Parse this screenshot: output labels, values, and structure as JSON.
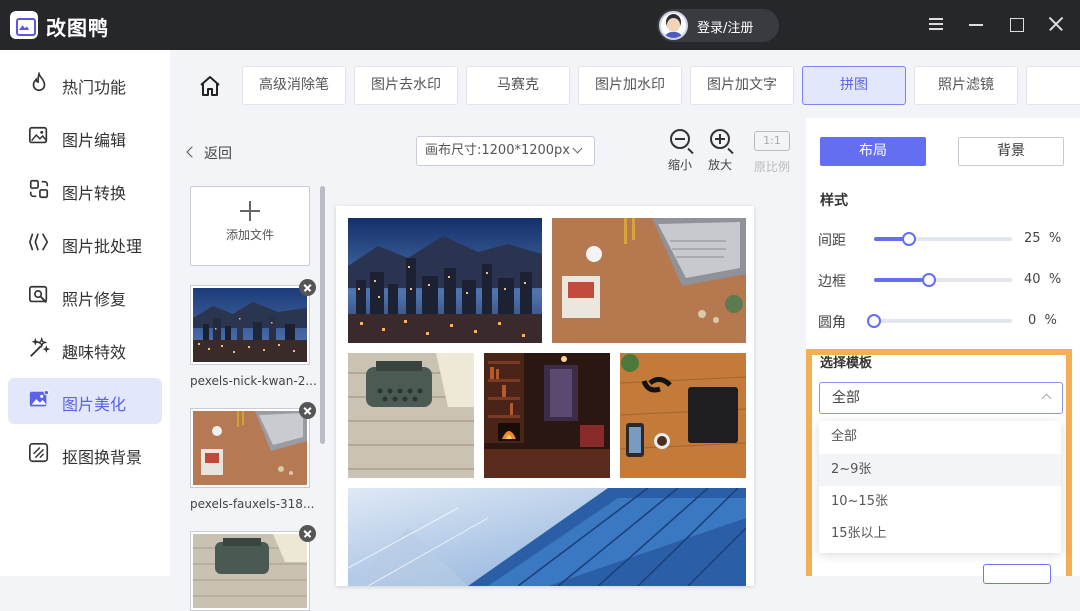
{
  "app": {
    "title": "改图鸭",
    "login_label": "登录/注册"
  },
  "sidebar": {
    "items": [
      {
        "label": "热门功能",
        "icon": "flame-icon"
      },
      {
        "label": "图片编辑",
        "icon": "image-edit-icon"
      },
      {
        "label": "图片转换",
        "icon": "convert-icon"
      },
      {
        "label": "图片批处理",
        "icon": "batch-icon"
      },
      {
        "label": "照片修复",
        "icon": "photo-repair-icon"
      },
      {
        "label": "趣味特效",
        "icon": "magic-wand-icon"
      },
      {
        "label": "图片美化",
        "icon": "beautify-icon",
        "active": true
      },
      {
        "label": "抠图换背景",
        "icon": "cutout-icon"
      }
    ]
  },
  "toolbar": {
    "tools": [
      {
        "label": "高级消除笔"
      },
      {
        "label": "图片去水印"
      },
      {
        "label": "马赛克"
      },
      {
        "label": "图片加水印"
      },
      {
        "label": "图片加文字"
      },
      {
        "label": "拼图",
        "active": true
      },
      {
        "label": "照片滤镜"
      }
    ]
  },
  "editor": {
    "back_label": "返回",
    "canvas_size": "画布尺寸:1200*1200px",
    "zoom_out_label": "缩小",
    "zoom_in_label": "放大",
    "ratio_button": "1:1",
    "ratio_label": "原比例"
  },
  "files": {
    "add_label": "添加文件",
    "items": [
      {
        "name": "pexels-nick-kwan-2...",
        "image": "city-night-skyline"
      },
      {
        "name": "pexels-fauxels-318...",
        "image": "desk-laptop"
      },
      {
        "name": "",
        "image": "typewriter"
      }
    ]
  },
  "collage": {
    "tiles": [
      {
        "name": "city-night-skyline"
      },
      {
        "name": "desk-laptop"
      },
      {
        "name": "typewriter"
      },
      {
        "name": "cozy-room-fireplace"
      },
      {
        "name": "desk-phone-glasses"
      },
      {
        "name": "glass-building"
      }
    ]
  },
  "right_panel": {
    "tab_layout": "布局",
    "tab_background": "背景",
    "style_title": "样式",
    "sliders": [
      {
        "label": "间距",
        "value": 25,
        "unit": "%"
      },
      {
        "label": "边框",
        "value": 40,
        "unit": "%"
      },
      {
        "label": "圆角",
        "value": 0,
        "unit": "%"
      }
    ],
    "template_title": "选择模板",
    "template_selected": "全部",
    "template_options": [
      "全部",
      "2~9张",
      "10~15张",
      "15张以上"
    ]
  },
  "colors": {
    "accent": "#636ef0",
    "highlight": "#f4ae56",
    "titlebar": "#26272b"
  }
}
